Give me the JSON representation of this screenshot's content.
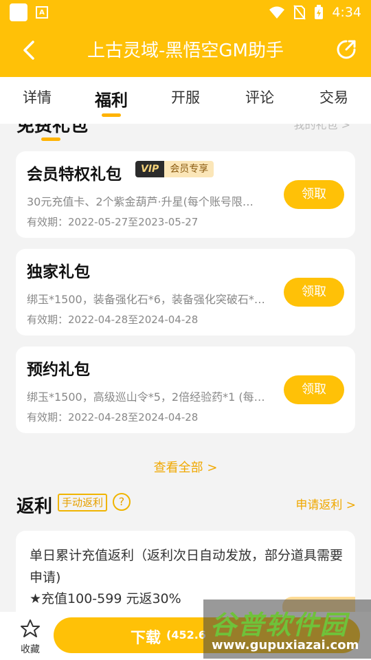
{
  "status_bar": {
    "time": "4:34",
    "app_badge": "A"
  },
  "header": {
    "title": "上古灵域-黑悟空GM助手"
  },
  "tabs": [
    {
      "label": "详情"
    },
    {
      "label": "福利"
    },
    {
      "label": "开服"
    },
    {
      "label": "评论"
    },
    {
      "label": "交易"
    }
  ],
  "gifts": {
    "section_title_partial": "免费礼包",
    "my_gifts_partial": "我的礼包 >",
    "items": [
      {
        "title": "会员特权礼包",
        "badge_logo": "VIP",
        "badge_text": "会员专享",
        "desc": "30元充值卡、2个紫金葫芦·升星(每个账号限…",
        "validity": "有效期：2022-05-27至2023-05-27",
        "button": "领取"
      },
      {
        "title": "独家礼包",
        "desc": "绑玉*1500，装备强化石*6，装备强化突破石*…",
        "validity": "有效期：2022-04-28至2024-04-28",
        "button": "领取"
      },
      {
        "title": "预约礼包",
        "desc": "绑玉*1500，高级巡山令*5，2倍经验药*1 (每…",
        "validity": "有效期：2022-04-28至2024-04-28",
        "button": "领取"
      }
    ],
    "view_all": "查看全部 >"
  },
  "rebate": {
    "title": "返利",
    "tag": "手动返利",
    "help": "?",
    "apply_link": "申请返利 >",
    "card_text": "单日累计充值返利（返利次日自动发放，部分道具需要申请)",
    "tier": "★充值100-599 元返30%"
  },
  "bottom": {
    "favorite_label": "收藏",
    "download_label": "下载",
    "download_size": "(452.6"
  },
  "watermark": {
    "main": "谷普软件园",
    "sub": "www.gupuxiazai.com"
  },
  "colors": {
    "accent": "#ffc107",
    "link": "#f0a800"
  }
}
